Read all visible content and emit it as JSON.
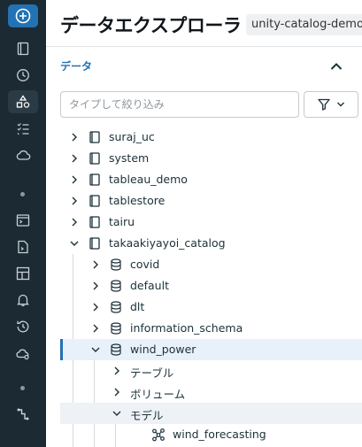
{
  "colors": {
    "sidebar_bg": "#1b2a33",
    "accent": "#2272b4",
    "selected_bg": "#e8f1fa"
  },
  "sidebar": {
    "items": [
      {
        "name": "new-icon"
      },
      {
        "name": "workspace-icon"
      },
      {
        "name": "recents-icon"
      },
      {
        "name": "catalog-icon"
      },
      {
        "name": "workflows-icon"
      },
      {
        "name": "compute-icon"
      },
      {
        "name": "sql-editor-icon"
      },
      {
        "name": "queries-icon"
      },
      {
        "name": "dashboards-icon"
      },
      {
        "name": "alerts-icon"
      },
      {
        "name": "query-history-icon"
      },
      {
        "name": "sql-warehouses-icon"
      },
      {
        "name": "partner-connect-icon"
      }
    ]
  },
  "header": {
    "title": "データエクスプローラ",
    "badge": "unity-catalog-demo"
  },
  "section": {
    "title": "データ"
  },
  "filter": {
    "placeholder": "タイプして絞り込み"
  },
  "tree": [
    {
      "label": "suraj_uc",
      "type": "catalog",
      "level": 0,
      "expanded": false
    },
    {
      "label": "system",
      "type": "catalog",
      "level": 0,
      "expanded": false
    },
    {
      "label": "tableau_demo",
      "type": "catalog",
      "level": 0,
      "expanded": false
    },
    {
      "label": "tablestore",
      "type": "catalog",
      "level": 0,
      "expanded": false
    },
    {
      "label": "tairu",
      "type": "catalog",
      "level": 0,
      "expanded": false
    },
    {
      "label": "takaakiyayoi_catalog",
      "type": "catalog",
      "level": 0,
      "expanded": true
    },
    {
      "label": "covid",
      "type": "schema",
      "level": 1,
      "expanded": false
    },
    {
      "label": "default",
      "type": "schema",
      "level": 1,
      "expanded": false
    },
    {
      "label": "dlt",
      "type": "schema",
      "level": 1,
      "expanded": false
    },
    {
      "label": "information_schema",
      "type": "schema",
      "level": 1,
      "expanded": false
    },
    {
      "label": "wind_power",
      "type": "schema",
      "level": 1,
      "expanded": true,
      "selected": true
    },
    {
      "label": "テーブル",
      "type": "group",
      "level": 2,
      "expanded": false
    },
    {
      "label": "ボリューム",
      "type": "group",
      "level": 2,
      "expanded": false
    },
    {
      "label": "モデル",
      "type": "group",
      "level": 2,
      "expanded": true,
      "hover": true
    },
    {
      "label": "wind_forecasting",
      "type": "model",
      "level": 3
    }
  ]
}
